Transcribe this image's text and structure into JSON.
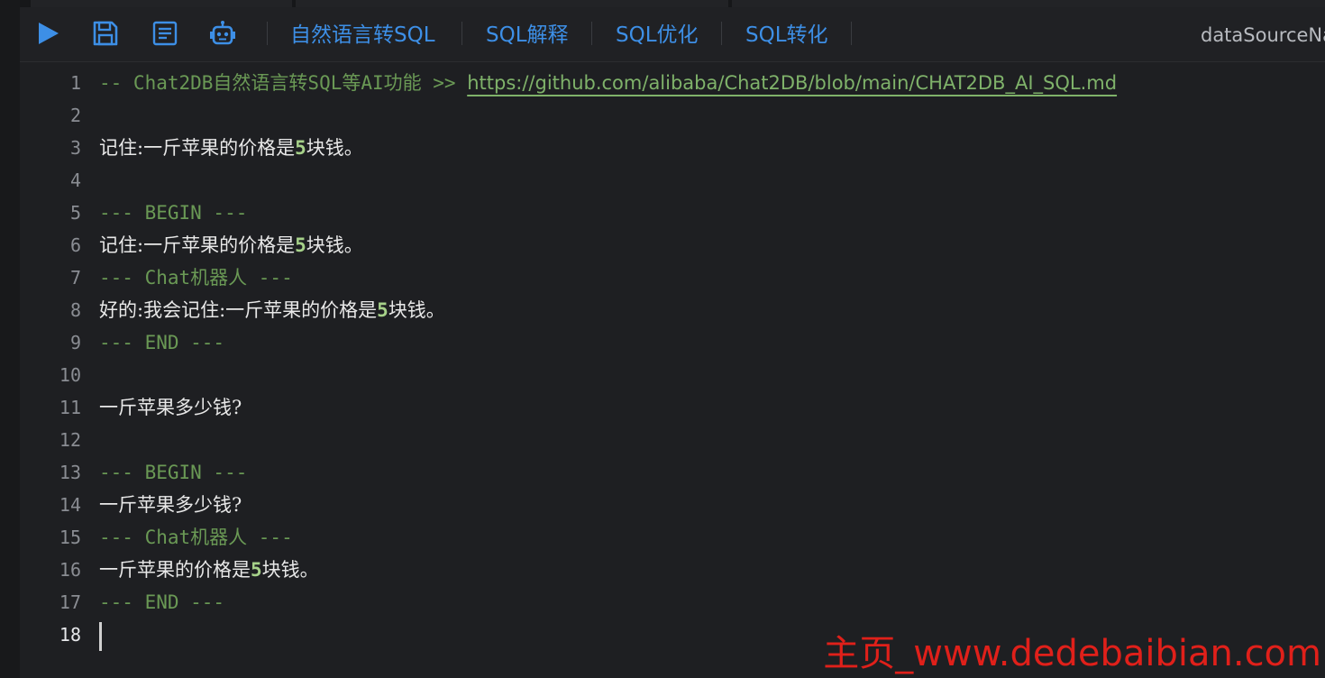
{
  "toolbar": {
    "buttons": [
      "自然语言转SQL",
      "SQL解释",
      "SQL优化",
      "SQL转化"
    ],
    "datasource_label": "dataSourceNa",
    "icons": [
      "play-icon",
      "save-icon",
      "format-icon",
      "robot-icon"
    ],
    "accent_color": "#3d8fe6"
  },
  "editor": {
    "active_line": 18,
    "lines": [
      {
        "num": "1",
        "parts": [
          {
            "t": "-- Chat2DB自然语言转SQL等AI功能 >> ",
            "c": "comment"
          },
          {
            "t": "https://github.com/alibaba/Chat2DB/blob/main/CHAT2DB_AI_SQL.md",
            "c": "link"
          }
        ]
      },
      {
        "num": "2",
        "parts": []
      },
      {
        "num": "3",
        "parts": [
          {
            "t": "记住:一斤苹果的价格是",
            "c": "text"
          },
          {
            "t": "5",
            "c": "num"
          },
          {
            "t": "块钱。",
            "c": "text"
          }
        ]
      },
      {
        "num": "4",
        "parts": []
      },
      {
        "num": "5",
        "parts": [
          {
            "t": "--- BEGIN ---",
            "c": "comment"
          }
        ]
      },
      {
        "num": "6",
        "parts": [
          {
            "t": "记住:一斤苹果的价格是",
            "c": "text"
          },
          {
            "t": "5",
            "c": "num"
          },
          {
            "t": "块钱。",
            "c": "text"
          }
        ]
      },
      {
        "num": "7",
        "parts": [
          {
            "t": "--- Chat机器人 ---",
            "c": "comment"
          }
        ]
      },
      {
        "num": "8",
        "parts": [
          {
            "t": "好的:我会记住:一斤苹果的价格是",
            "c": "text"
          },
          {
            "t": "5",
            "c": "num"
          },
          {
            "t": "块钱。",
            "c": "text"
          }
        ]
      },
      {
        "num": "9",
        "parts": [
          {
            "t": "--- END ---",
            "c": "comment"
          }
        ]
      },
      {
        "num": "10",
        "parts": []
      },
      {
        "num": "11",
        "parts": [
          {
            "t": "一斤苹果多少钱?",
            "c": "text"
          }
        ]
      },
      {
        "num": "12",
        "parts": []
      },
      {
        "num": "13",
        "parts": [
          {
            "t": "--- BEGIN ---",
            "c": "comment"
          }
        ]
      },
      {
        "num": "14",
        "parts": [
          {
            "t": "一斤苹果多少钱?",
            "c": "text"
          }
        ]
      },
      {
        "num": "15",
        "parts": [
          {
            "t": "--- Chat机器人 ---",
            "c": "comment"
          }
        ]
      },
      {
        "num": "16",
        "parts": [
          {
            "t": "一斤苹果的价格是",
            "c": "text"
          },
          {
            "t": "5",
            "c": "num"
          },
          {
            "t": "块钱。",
            "c": "text"
          }
        ]
      },
      {
        "num": "17",
        "parts": [
          {
            "t": "--- END ---",
            "c": "comment"
          }
        ]
      },
      {
        "num": "18",
        "parts": []
      }
    ]
  },
  "watermark": "主页_www.dedebaibian.com"
}
